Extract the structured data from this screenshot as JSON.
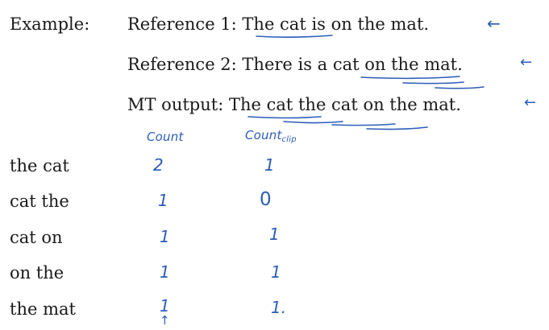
{
  "example": {
    "label": "Example:",
    "reference1": {
      "prefix": "Reference 1: ",
      "underlined": "The cat",
      "rest": " is on the mat."
    },
    "reference2": {
      "prefix": "Reference 2: There is a ",
      "underlined": "cat on the",
      "rest": " mat."
    },
    "mt_output": {
      "prefix": "MT output: ",
      "underlined": "The cat the cat on the",
      "rest": " mat."
    }
  },
  "annotations": {
    "arrow_glyph": "←",
    "up_arrow_glyph": "↑"
  },
  "table": {
    "count_header": "Count",
    "count_clip_header_main": "Count",
    "count_clip_header_sub": "clip",
    "rows": [
      {
        "bigram": "the cat",
        "count": "2",
        "count_clip": "1"
      },
      {
        "bigram": "cat the",
        "count": "1",
        "count_clip": "0"
      },
      {
        "bigram": "cat on",
        "count": "1",
        "count_clip": "1"
      },
      {
        "bigram": "on the",
        "count": "1",
        "count_clip": "1"
      },
      {
        "bigram": "the mat",
        "count": "1",
        "count_clip": "1."
      }
    ]
  },
  "colors": {
    "ink": "#2c5cb8",
    "text": "#1a1a1a"
  }
}
